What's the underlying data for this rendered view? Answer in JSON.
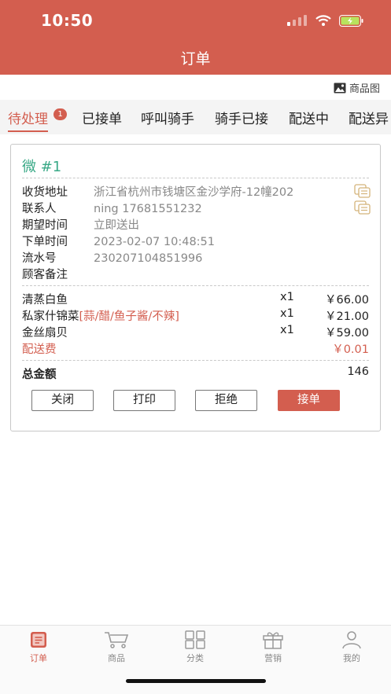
{
  "status_bar": {
    "time": "10:50"
  },
  "header": {
    "title": "订单"
  },
  "photo_toggle": {
    "label": "商品图"
  },
  "tabs": [
    {
      "label": "待处理",
      "badge": "1",
      "active": true
    },
    {
      "label": "已接单"
    },
    {
      "label": "呼叫骑手"
    },
    {
      "label": "骑手已接"
    },
    {
      "label": "配送中"
    },
    {
      "label": "配送异"
    }
  ],
  "order": {
    "number": "微 #1",
    "info": [
      {
        "label": "收货地址",
        "value": "浙江省杭州市钱塘区金沙学府-12幢202"
      },
      {
        "label": "联系人",
        "value": "ning 17681551232"
      },
      {
        "label": "期望时间",
        "value": "立即送出"
      },
      {
        "label": "下单时间",
        "value": "2023-02-07 10:48:51"
      },
      {
        "label": "流水号",
        "value": "230207104851996"
      },
      {
        "label": "顾客备注",
        "value": ""
      }
    ],
    "items": [
      {
        "name": "清蒸白鱼",
        "spec": "",
        "qty": "x1",
        "price": "￥66.00"
      },
      {
        "name": "私家什锦菜",
        "spec": "[蒜/醋/鱼子酱/不辣]",
        "qty": "x1",
        "price": "￥21.00"
      },
      {
        "name": "金丝扇贝",
        "spec": "",
        "qty": "x1",
        "price": "￥59.00"
      }
    ],
    "delivery_fee": {
      "label": "配送费",
      "value": "￥0.01"
    },
    "total": {
      "label": "总金额",
      "value": "146"
    },
    "actions": {
      "close": "关闭",
      "print": "打印",
      "reject": "拒绝",
      "accept": "接单"
    }
  },
  "tabbar": [
    {
      "label": "订单",
      "icon": "order-icon",
      "active": true
    },
    {
      "label": "商品",
      "icon": "cart-icon"
    },
    {
      "label": "分类",
      "icon": "grid-icon"
    },
    {
      "label": "营销",
      "icon": "gift-icon"
    },
    {
      "label": "我的",
      "icon": "person-icon"
    }
  ],
  "colors": {
    "brand": "#d35e4f",
    "order_number": "#3aa987",
    "tab_background": "#f4f4f4"
  }
}
